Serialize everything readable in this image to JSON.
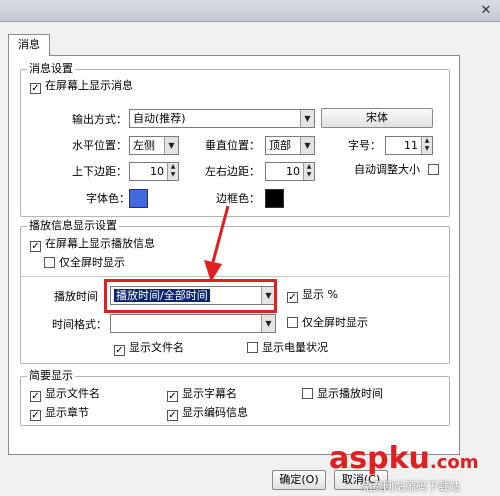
{
  "window": {
    "close_glyph": "✕"
  },
  "tab": {
    "label": "消息"
  },
  "message_settings": {
    "title": "消息设置",
    "show_on_screen": {
      "label": "在屏幕上显示消息",
      "checked": true
    },
    "output_mode": {
      "label": "输出方式：",
      "value": "自动(推荐)"
    },
    "font_button": "宋体",
    "h_position": {
      "label": "水平位置：",
      "value": "左侧"
    },
    "v_position": {
      "label": "垂直位置：",
      "value": "顶部"
    },
    "font_size": {
      "label": "字号：",
      "value": "11"
    },
    "v_margin": {
      "label": "上下边距：",
      "value": "10"
    },
    "h_margin": {
      "label": "左右边距：",
      "value": "10"
    },
    "auto_size": {
      "label": "自动调整大小",
      "checked": false
    },
    "font_color": {
      "label": "字体色：",
      "color": "#4169e1"
    },
    "border_color": {
      "label": "边框色：",
      "color": "#000000"
    }
  },
  "playback_info": {
    "title": "播放信息显示设置",
    "show_on_screen": {
      "label": "在屏幕上显示播放信息",
      "checked": true
    },
    "fullscreen_only": {
      "label": "仅全屏时显示",
      "checked": false
    },
    "play_time": {
      "label": "播放时间",
      "value": "播放时间/全部时间"
    },
    "show_percent": {
      "label": "显示 %",
      "checked": true
    },
    "time_format": {
      "label": "时间格式：",
      "value": ""
    },
    "fullscreen_only2": {
      "label": "仅全屏时显示",
      "checked": false
    },
    "show_filename": {
      "label": "显示文件名",
      "checked": true
    },
    "show_battery": {
      "label": "显示电量状况",
      "checked": false
    }
  },
  "brief": {
    "title": "简要显示",
    "items": [
      {
        "label": "显示文件名",
        "checked": true
      },
      {
        "label": "显示字幕名",
        "checked": true
      },
      {
        "label": "显示播放时间",
        "checked": false
      },
      {
        "label": "显示章节",
        "checked": true
      },
      {
        "label": "显示编码信息",
        "checked": true
      }
    ]
  },
  "buttons": {
    "ok": "确定(O)",
    "cancel": "取消(C)"
  },
  "watermark": {
    "brand": "aspku",
    "suffix": ".com",
    "slogan": "免费网站源码下载站"
  },
  "colors": {
    "highlight": "#e02020",
    "arrow": "#e02020",
    "selection": "#0a246a"
  }
}
